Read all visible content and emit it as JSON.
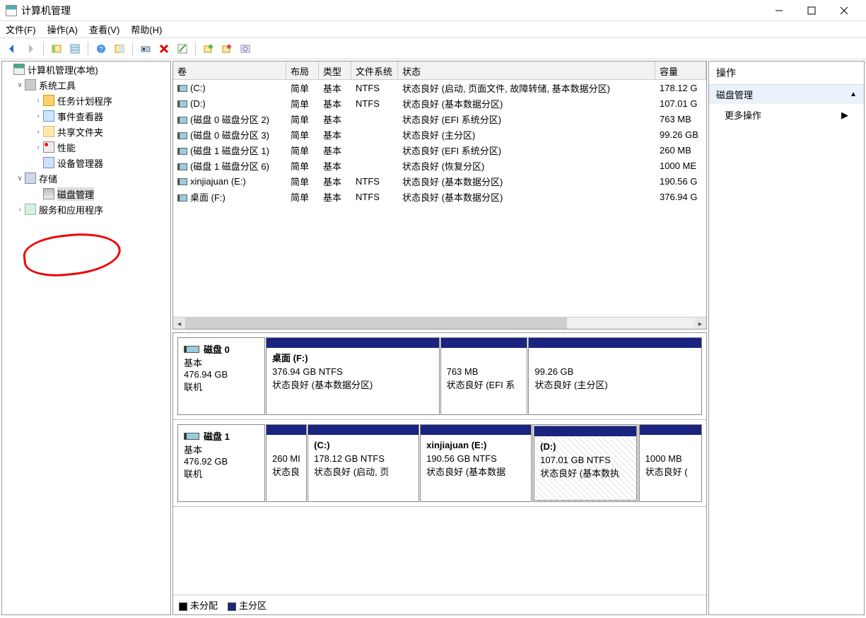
{
  "window": {
    "title": "计算机管理"
  },
  "menu": {
    "file": "文件(F)",
    "action": "操作(A)",
    "view": "查看(V)",
    "help": "帮助(H)"
  },
  "tree": {
    "root": "计算机管理(本地)",
    "system_tools": "系统工具",
    "task_scheduler": "任务计划程序",
    "event_viewer": "事件查看器",
    "shared_folders": "共享文件夹",
    "performance": "性能",
    "device_manager": "设备管理器",
    "storage": "存储",
    "disk_management": "磁盘管理",
    "services_apps": "服务和应用程序"
  },
  "vol_headers": {
    "volume": "卷",
    "layout": "布局",
    "type": "类型",
    "fs": "文件系统",
    "status": "状态",
    "capacity": "容量"
  },
  "volumes": [
    {
      "name": "(C:)",
      "layout": "简单",
      "type": "基本",
      "fs": "NTFS",
      "status": "状态良好 (启动, 页面文件, 故障转储, 基本数据分区)",
      "capacity": "178.12 G"
    },
    {
      "name": "(D:)",
      "layout": "简单",
      "type": "基本",
      "fs": "NTFS",
      "status": "状态良好 (基本数据分区)",
      "capacity": "107.01 G"
    },
    {
      "name": "(磁盘 0 磁盘分区 2)",
      "layout": "简单",
      "type": "基本",
      "fs": "",
      "status": "状态良好 (EFI 系统分区)",
      "capacity": "763 MB"
    },
    {
      "name": "(磁盘 0 磁盘分区 3)",
      "layout": "简单",
      "type": "基本",
      "fs": "",
      "status": "状态良好 (主分区)",
      "capacity": "99.26 GB"
    },
    {
      "name": "(磁盘 1 磁盘分区 1)",
      "layout": "简单",
      "type": "基本",
      "fs": "",
      "status": "状态良好 (EFI 系统分区)",
      "capacity": "260 MB"
    },
    {
      "name": "(磁盘 1 磁盘分区 6)",
      "layout": "简单",
      "type": "基本",
      "fs": "",
      "status": "状态良好 (恢复分区)",
      "capacity": "1000 ME"
    },
    {
      "name": "xinjiajuan (E:)",
      "layout": "简单",
      "type": "基本",
      "fs": "NTFS",
      "status": "状态良好 (基本数据分区)",
      "capacity": "190.56 G"
    },
    {
      "name": "桌面 (F:)",
      "layout": "简单",
      "type": "基本",
      "fs": "NTFS",
      "status": "状态良好 (基本数据分区)",
      "capacity": "376.94 G"
    }
  ],
  "disk0": {
    "name": "磁盘 0",
    "type": "基本",
    "size": "476.94 GB",
    "online": "联机",
    "p1_name": "桌面  (F:)",
    "p1_size": "376.94 GB NTFS",
    "p1_status": "状态良好 (基本数据分区)",
    "p2_size": "763 MB",
    "p2_status": "状态良好 (EFI 系",
    "p3_size": "99.26 GB",
    "p3_status": "状态良好 (主分区)"
  },
  "disk1": {
    "name": "磁盘 1",
    "type": "基本",
    "size": "476.92 GB",
    "online": "联机",
    "p1_size": "260 MI",
    "p1_status": "状态良",
    "p2_name": "(C:)",
    "p2_size": "178.12 GB NTFS",
    "p2_status": "状态良好 (启动, 页",
    "p3_name": "xinjiajuan  (E:)",
    "p3_size": "190.56 GB NTFS",
    "p3_status": "状态良好 (基本数据",
    "p4_name": "(D:)",
    "p4_size": "107.01 GB NTFS",
    "p4_status": "状态良好 (基本数执",
    "p5_size": "1000 MB",
    "p5_status": "状态良好 ("
  },
  "legend": {
    "unallocated": "未分配",
    "primary": "主分区"
  },
  "actions": {
    "title": "操作",
    "group": "磁盘管理",
    "more": "更多操作"
  }
}
